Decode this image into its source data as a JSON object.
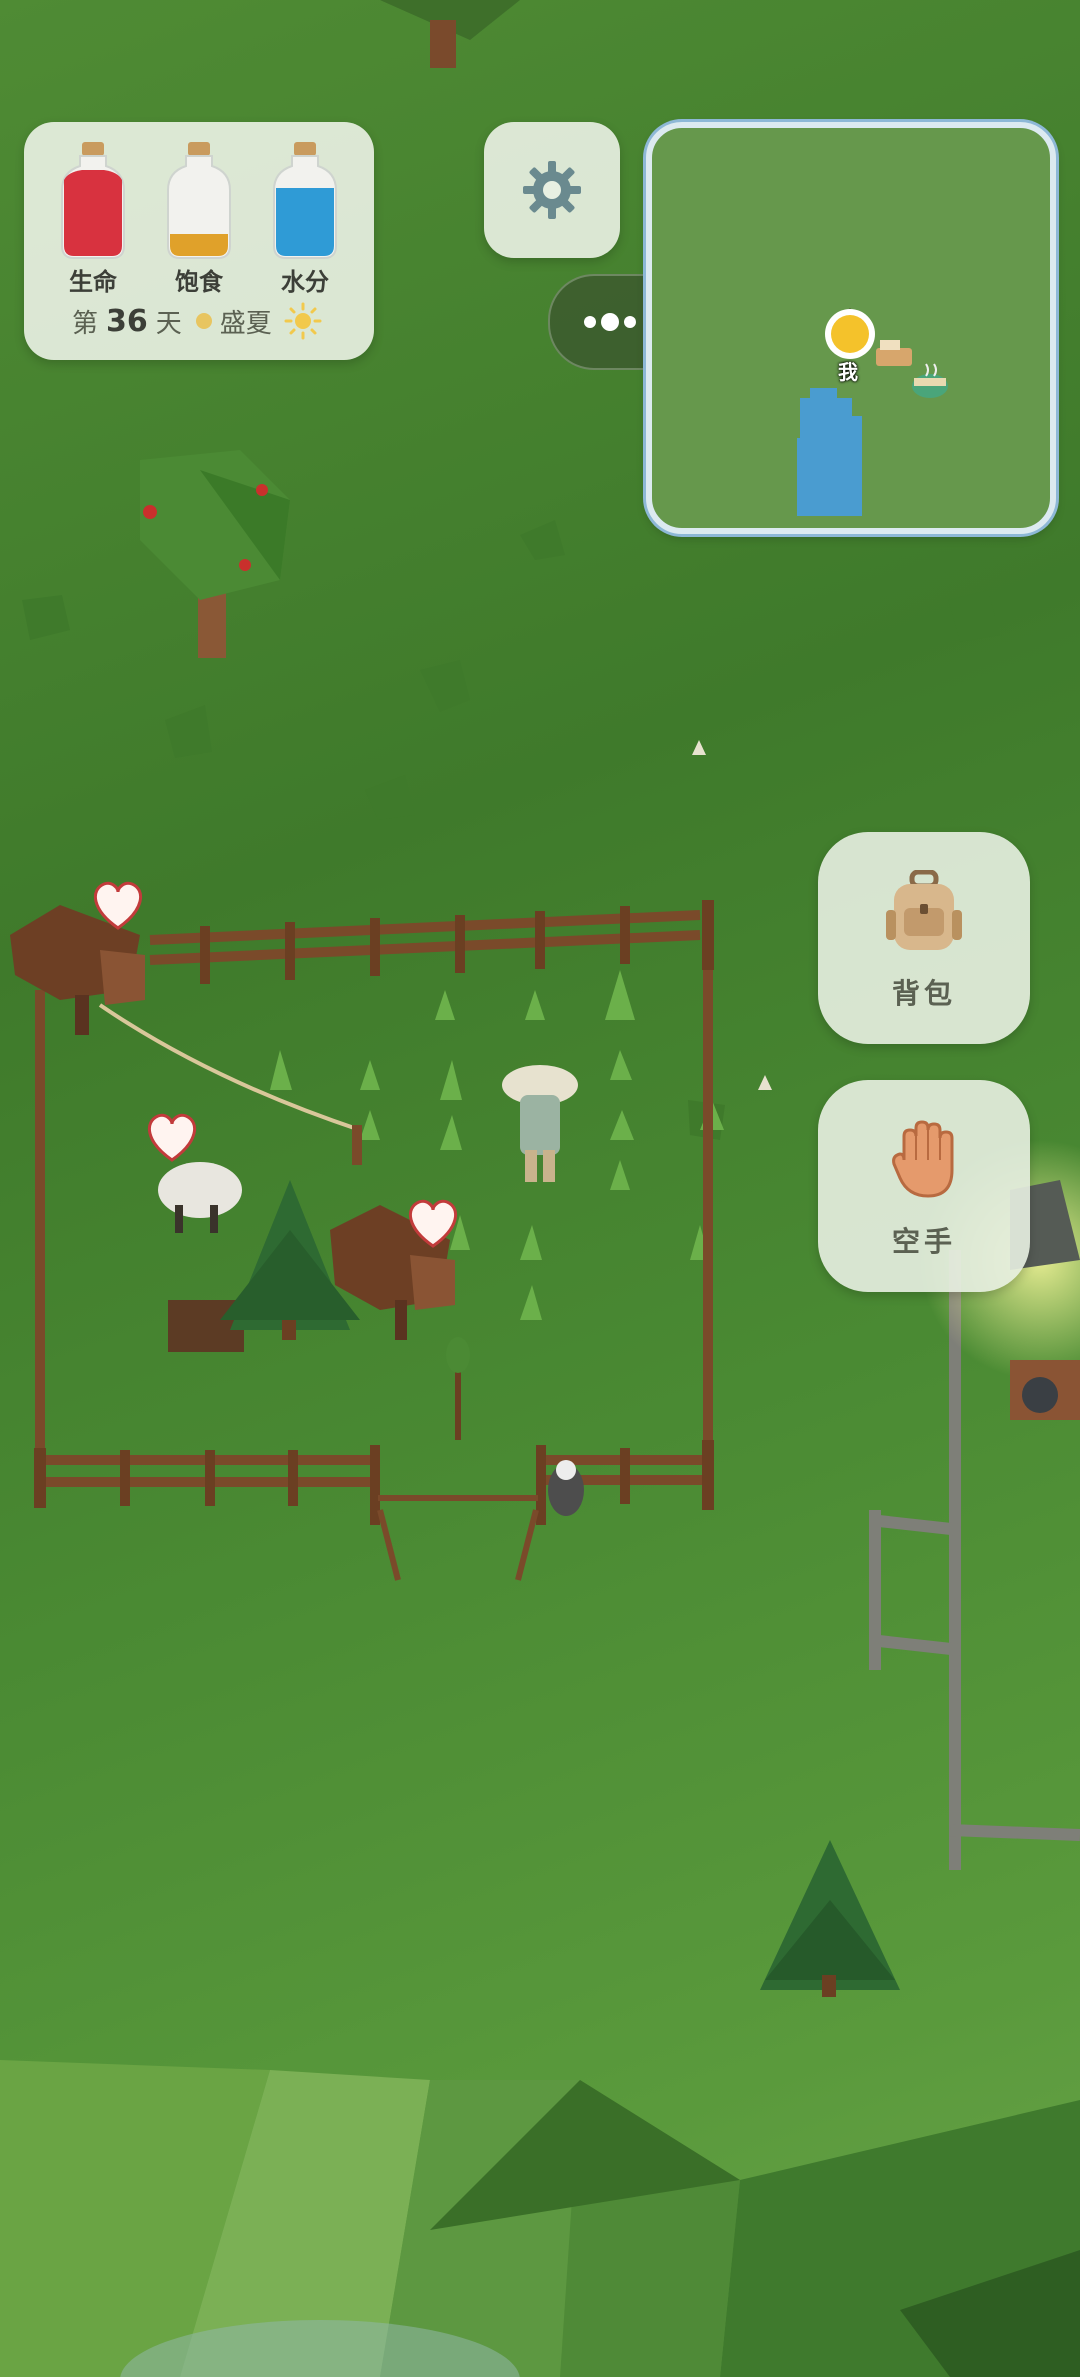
{
  "stats": [
    {
      "label": "生命",
      "color": "#d8323f"
    },
    {
      "label": "饱食",
      "color": "#e0a12a"
    },
    {
      "label": "水分",
      "color": "#2f9bd6"
    }
  ],
  "day": {
    "prefix": "第",
    "number": "36",
    "suffix": "天",
    "season": "盛夏"
  },
  "minimap": {
    "me_label": "我"
  },
  "actions": {
    "backpack_label": "背包",
    "hand_label": "空手"
  },
  "icons": {
    "settings": "gear-icon",
    "menu": "more-dots-icon",
    "target": "target-icon",
    "backpack": "backpack-icon",
    "hand": "hand-icon",
    "sun": "sun-icon"
  }
}
